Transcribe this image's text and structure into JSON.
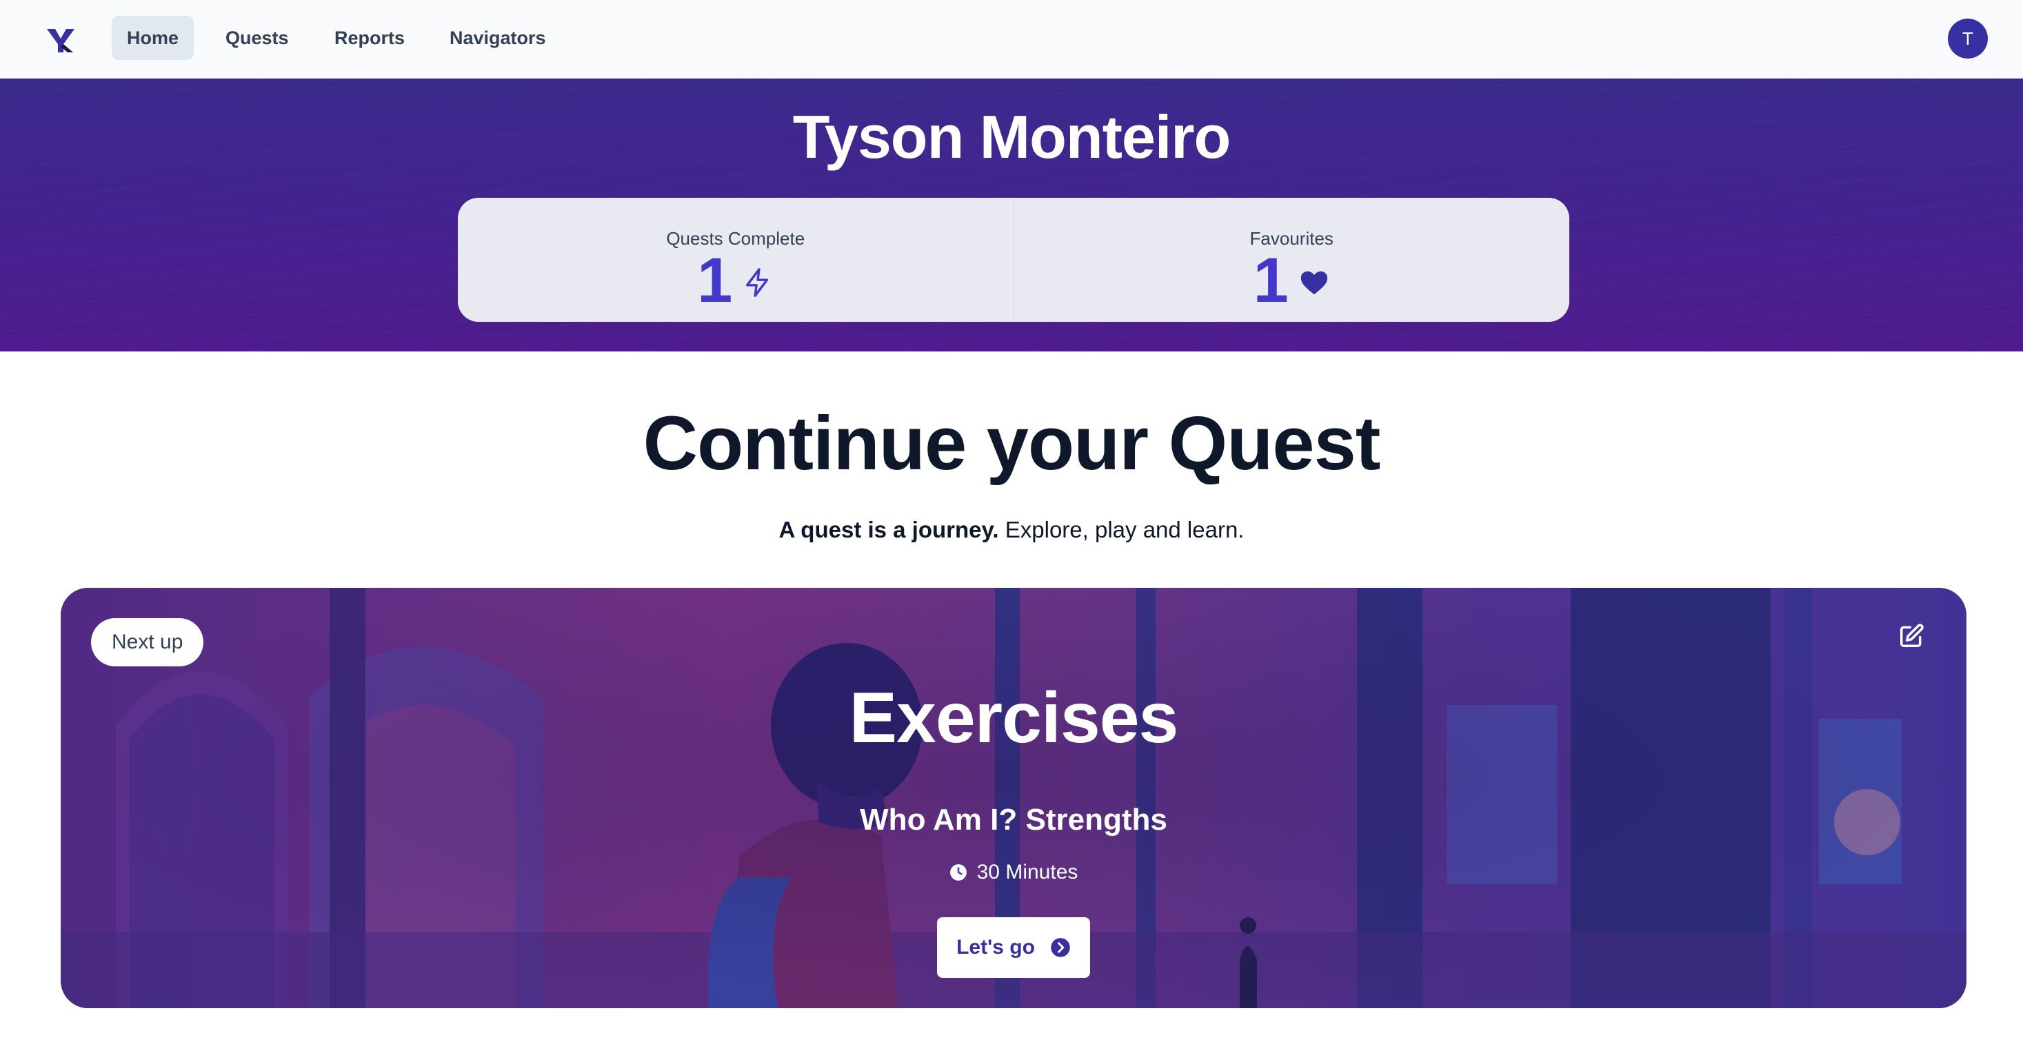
{
  "nav": {
    "logo_icon": "brand-y-logo",
    "items": [
      {
        "label": "Home",
        "active": true
      },
      {
        "label": "Quests",
        "active": false
      },
      {
        "label": "Reports",
        "active": false
      },
      {
        "label": "Navigators",
        "active": false
      }
    ],
    "avatar_initial": "T"
  },
  "hero": {
    "name": "Tyson Monteiro",
    "stats": [
      {
        "label": "Quests Complete",
        "value": "1",
        "icon": "lightning-icon"
      },
      {
        "label": "Favourites",
        "value": "1",
        "icon": "heart-icon"
      }
    ]
  },
  "continue": {
    "title": "Continue your Quest",
    "subtitle_bold": "A quest is a journey.",
    "subtitle_rest": " Explore, play and learn."
  },
  "quest_card": {
    "badge": "Next up",
    "title": "Exercises",
    "subtitle": "Who Am I? Strengths",
    "duration": "30 Minutes",
    "cta": "Let's go",
    "edit_icon": "edit-icon",
    "clock_icon": "clock-icon",
    "cta_icon": "chevron-circle-right-icon"
  },
  "colors": {
    "accent": "#4338ca",
    "hero_bg": "#45228f",
    "nav_bg": "#f8fafc"
  }
}
